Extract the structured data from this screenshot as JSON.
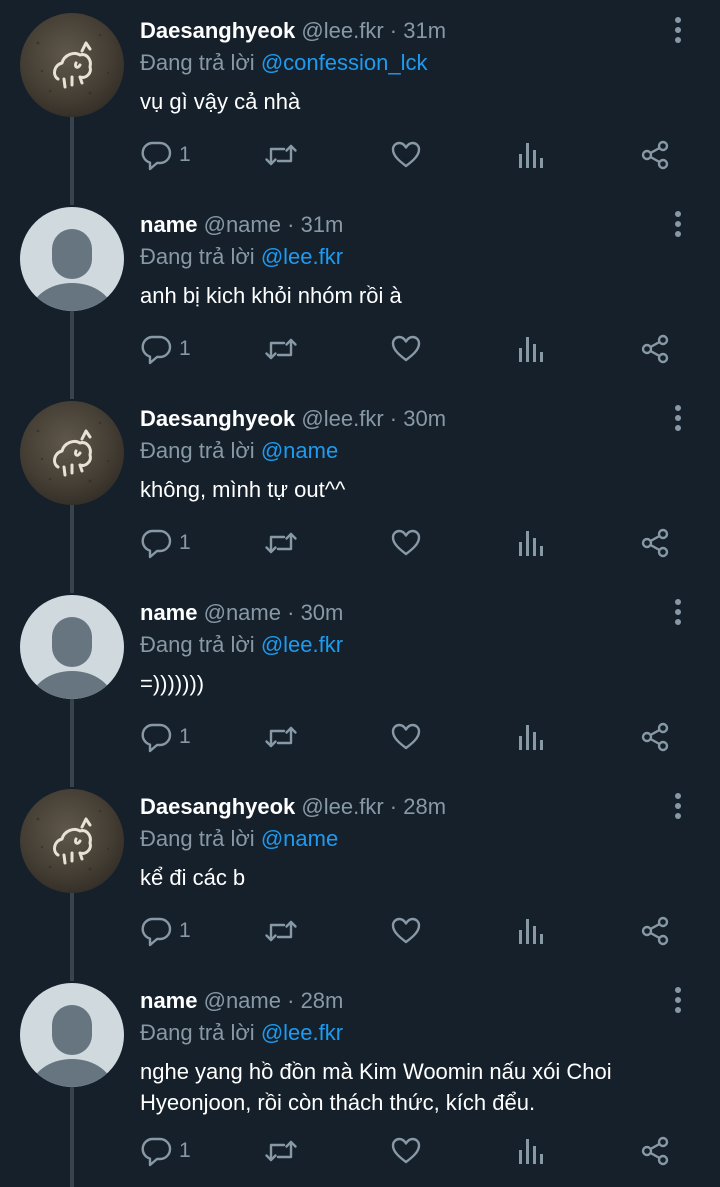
{
  "colors": {
    "background": "#15202b",
    "text_primary": "#ffffff",
    "text_secondary": "#8899a6",
    "accent_mention": "#1d9bf0",
    "thread_line": "#38444d",
    "avatar_default_bg": "#cfd9de",
    "avatar_default_figure": "#66757f"
  },
  "reply_prefix": "Đang trả lời",
  "tweets": [
    {
      "name": "Daesanghyeok",
      "handle": "@lee.fkr",
      "dot": "·",
      "time": "31m",
      "reply_to": "@confession_lck",
      "text": "vụ gì vậy cả nhà",
      "reply_count": "1",
      "avatar": "sketch-avatar"
    },
    {
      "name": "name",
      "handle": "@name",
      "dot": "·",
      "time": "31m",
      "reply_to": "@lee.fkr",
      "text": "anh bị kich khỏi nhóm rồi à",
      "reply_count": "1",
      "avatar": "default-avatar"
    },
    {
      "name": "Daesanghyeok",
      "handle": "@lee.fkr",
      "dot": "·",
      "time": "30m",
      "reply_to": "@name",
      "text": "không, mình tự out^^",
      "reply_count": "1",
      "avatar": "sketch-avatar"
    },
    {
      "name": "name",
      "handle": "@name",
      "dot": "·",
      "time": "30m",
      "reply_to": "@lee.fkr",
      "text": "=)))))))",
      "reply_count": "1",
      "avatar": "default-avatar"
    },
    {
      "name": "Daesanghyeok",
      "handle": "@lee.fkr",
      "dot": "·",
      "time": "28m",
      "reply_to": "@name",
      "text": "kể đi các b",
      "reply_count": "1",
      "avatar": "sketch-avatar"
    },
    {
      "name": "name",
      "handle": "@name",
      "dot": "·",
      "time": "28m",
      "reply_to": "@lee.fkr",
      "text": "nghe yang hồ đồn mà Kim Woomin nấu xói Choi Hyeonjoon, rồi còn thách thức, kích đểu.",
      "reply_count": "1",
      "avatar": "default-avatar"
    }
  ],
  "action_icons": [
    "reply-icon",
    "retweet-icon",
    "like-icon",
    "views-icon",
    "share-icon"
  ],
  "menu_icon": "more-options-icon"
}
